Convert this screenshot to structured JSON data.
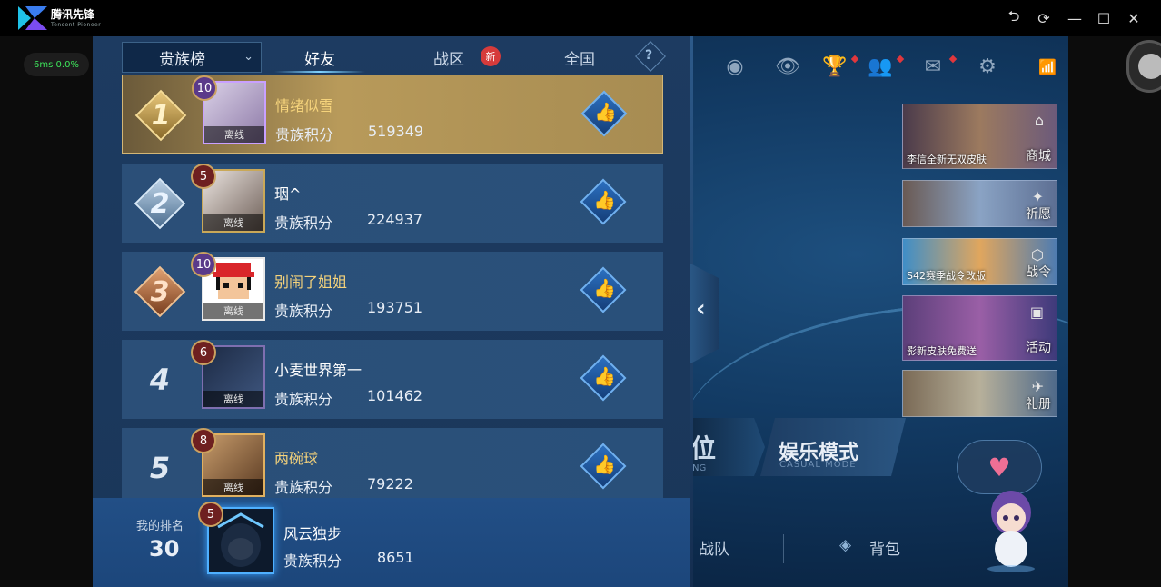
{
  "app": {
    "title": "腾讯先锋",
    "subtitle": "Tencent Pioneer",
    "fps": "6ms  0.0%"
  },
  "window_controls": {
    "back": "⮌",
    "refresh": "⟳",
    "minimize": "—",
    "maximize": "☐",
    "close": "✕"
  },
  "leaderboard": {
    "dropdown_label": "贵族榜",
    "tabs": [
      {
        "label": "好友",
        "active": true
      },
      {
        "label": "战区",
        "badge": "新"
      },
      {
        "label": "全国"
      }
    ],
    "help": "?",
    "rows": [
      {
        "rank": "1",
        "level": "10",
        "name": "情绪似雪",
        "status": "离线",
        "score_label": "贵族积分",
        "score": "519349"
      },
      {
        "rank": "2",
        "level": "5",
        "name": "珚^",
        "status": "离线",
        "score_label": "贵族积分",
        "score": "224937"
      },
      {
        "rank": "3",
        "level": "10",
        "name": "别闹了姐姐",
        "status": "离线",
        "score_label": "贵族积分",
        "score": "193751"
      },
      {
        "rank": "4",
        "level": "6",
        "name": "小麦世界第一",
        "status": "离线",
        "score_label": "贵族积分",
        "score": "101462"
      },
      {
        "rank": "5",
        "level": "8",
        "name": "两碗球",
        "status": "离线",
        "score_label": "贵族积分",
        "score": "79222"
      }
    ],
    "my_rank": {
      "label": "我的排名",
      "rank": "30",
      "level": "5",
      "name": "风云独步",
      "score_label": "贵族积分",
      "score": "8651"
    }
  },
  "promos": [
    {
      "caption": "李信全新无双皮肤",
      "label": "商城"
    },
    {
      "caption": "",
      "label": "祈愿"
    },
    {
      "caption": "S42赛季战令改版",
      "label": "战令"
    },
    {
      "caption": "影新皮肤免费送",
      "label": "活动"
    },
    {
      "caption": "",
      "label": "礼册"
    }
  ],
  "modes": {
    "rank_fragment": "位",
    "rank_fragment_sub": "NG",
    "casual_title": "娱乐模式",
    "casual_sub": "CASUAL MODE"
  },
  "bottom_bar": {
    "team": "战队",
    "bag": "背包"
  },
  "colors": {
    "panel": "#1d3b61",
    "gold_row": "#b89a5a",
    "accent_blue": "#4fb0ff"
  }
}
